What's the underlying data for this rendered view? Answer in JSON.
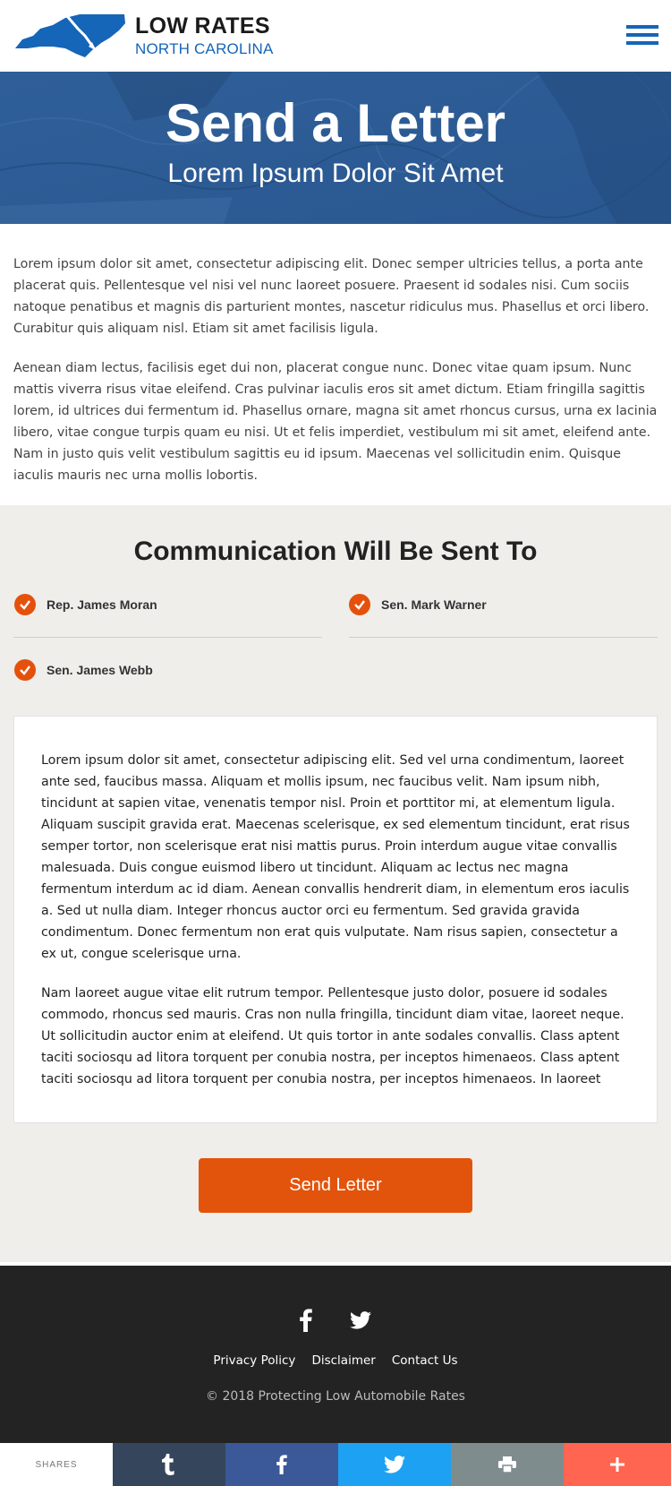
{
  "header": {
    "logo_line1": "LOW RATES",
    "logo_line2": "NORTH CAROLINA",
    "menu_icon": "hamburger-menu-icon"
  },
  "hero": {
    "title": "Send a Letter",
    "subtitle": "Lorem Ipsum Dolor Sit Amet"
  },
  "intro": {
    "paragraphs": [
      "Lorem ipsum dolor sit amet, consectetur adipiscing elit. Donec semper ultricies tellus, a porta ante placerat quis. Pellentesque vel nisi vel nunc laoreet posuere. Praesent id sodales nisi. Cum sociis natoque penatibus et magnis dis parturient montes, nascetur ridiculus mus. Phasellus et orci libero. Curabitur quis aliquam nisl. Etiam sit amet facilisis ligula.",
      "Aenean diam lectus, facilisis eget dui non, placerat congue nunc. Donec vitae quam ipsum. Nunc mattis viverra risus vitae eleifend. Cras pulvinar iaculis eros sit amet dictum. Etiam fringilla sagittis lorem, id ultrices dui fermentum id. Phasellus ornare, magna sit amet rhoncus cursus, urna ex lacinia libero, vitae congue turpis quam eu nisi. Ut et felis imperdiet, vestibulum mi sit amet, eleifend ante. Nam in justo quis velit vestibulum sagittis eu id ipsum. Maecenas vel sollicitudin enim. Quisque iaculis mauris nec urna mollis lobortis."
    ]
  },
  "recipients": {
    "title": "Communication Will Be Sent To",
    "items": [
      {
        "name": "Rep. James Moran"
      },
      {
        "name": "Sen. Mark Warner"
      },
      {
        "name": "Sen. James Webb"
      }
    ]
  },
  "letter": {
    "paragraphs": [
      "Lorem ipsum dolor sit amet, consectetur adipiscing elit. Sed vel urna condimentum, laoreet ante sed, faucibus massa. Aliquam et mollis ipsum, nec faucibus velit. Nam ipsum nibh, tincidunt at sapien vitae, venenatis tempor nisl. Proin et porttitor mi, at elementum ligula. Aliquam suscipit gravida erat. Maecenas scelerisque, ex sed elementum tincidunt, erat risus semper tortor, non scelerisque erat nisi mattis purus. Proin interdum augue vitae convallis malesuada. Duis congue euismod libero ut tincidunt. Aliquam ac lectus nec magna fermentum interdum ac id diam. Aenean convallis hendrerit diam, in elementum eros iaculis a. Sed ut nulla diam. Integer rhoncus auctor orci eu fermentum. Sed gravida gravida condimentum. Donec fermentum non erat quis vulputate. Nam risus sapien, consectetur a ex ut, congue scelerisque urna.",
      "Nam laoreet augue vitae elit rutrum tempor. Pellentesque justo dolor, posuere id sodales commodo, rhoncus sed mauris. Cras non nulla fringilla, tincidunt diam vitae, laoreet neque. Ut sollicitudin auctor enim at eleifend. Ut quis tortor in ante sodales convallis. Class aptent taciti sociosqu ad litora torquent per conubia nostra, per inceptos himenaeos. Class aptent taciti sociosqu ad litora torquent per conubia nostra, per inceptos himenaeos. In laoreet tellus mi, ac semper mauris viverra quis. Sed ut hendrerit turpis. Phasellus congue aliquam orci et rutrum. Sed"
    ]
  },
  "send_button": "Send Letter",
  "footer": {
    "social": [
      "facebook-icon",
      "twitter-icon"
    ],
    "links": [
      "Privacy Policy",
      "Disclaimer",
      "Contact Us"
    ],
    "copyright": "© 2018 Protecting Low Automobile Rates"
  },
  "sharebar": {
    "label": "SHARES",
    "buttons": [
      {
        "icon": "tumblr-icon",
        "color": "#35465c"
      },
      {
        "icon": "facebook-icon",
        "color": "#3b5998"
      },
      {
        "icon": "twitter-icon",
        "color": "#1da1f2"
      },
      {
        "icon": "print-icon",
        "color": "#7f8c8d"
      },
      {
        "icon": "plus-icon",
        "color": "#ff6550"
      }
    ]
  },
  "colors": {
    "brand_blue": "#1565b8",
    "accent_orange": "#e4510d",
    "hero_blue": "#2b5b94",
    "footer_bg": "#232323"
  }
}
